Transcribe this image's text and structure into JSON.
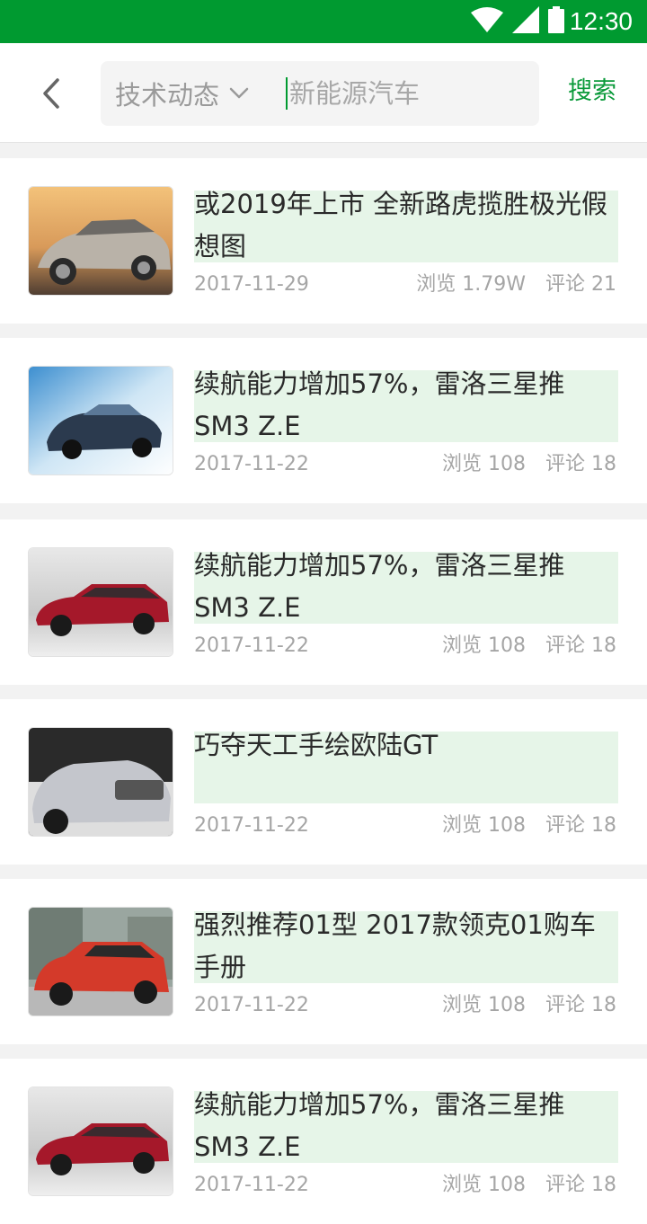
{
  "status_bar": {
    "time": "12:30",
    "icons": [
      "wifi-icon",
      "signal-icon",
      "battery-icon"
    ],
    "background": "#009a30"
  },
  "header": {
    "category": "技术动态",
    "search_placeholder": "新能源汽车",
    "search_button": "搜索",
    "accent_color": "#009a30"
  },
  "articles": [
    {
      "title": "或2019年上市 全新路虎揽胜极光假想图",
      "date": "2017-11-29",
      "views": "浏览 1.79W",
      "comments": "评论 21",
      "thumb": "silver-suv-sunset"
    },
    {
      "title": "续航能力增加57%，雷洛三星推SM3 Z.E",
      "date": "2017-11-22",
      "views": "浏览 108",
      "comments": "评论 18",
      "thumb": "dark-sedan-blue"
    },
    {
      "title": "续航能力增加57%，雷洛三星推SM3 Z.E",
      "date": "2017-11-22",
      "views": "浏览 108",
      "comments": "评论 18",
      "thumb": "red-wagon"
    },
    {
      "title": "巧夺天工手绘欧陆GT",
      "date": "2017-11-22",
      "views": "浏览 108",
      "comments": "评论 18",
      "thumb": "silver-coupe"
    },
    {
      "title": "强烈推荐01型 2017款领克01购车手册",
      "date": "2017-11-22",
      "views": "浏览 108",
      "comments": "评论 18",
      "thumb": "red-suv"
    },
    {
      "title": "续航能力增加57%，雷洛三星推SM3 Z.E",
      "date": "2017-11-22",
      "views": "浏览 108",
      "comments": "评论 18",
      "thumb": "red-wagon"
    }
  ]
}
